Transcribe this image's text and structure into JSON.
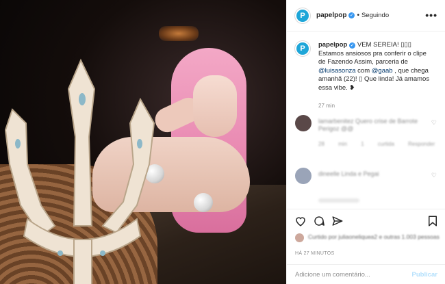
{
  "post": {
    "username": "papelpop",
    "follow_status": "Seguindo",
    "dot": "•",
    "more": "•••",
    "avatar_letter": "P"
  },
  "caption": {
    "username": "papelpop",
    "line1": " VEM SEREIA! ",
    "emoji": "▯▯▯",
    "line2": "Estamos ansiosos pra conferir o clipe de Fazendo Assim, parceria de ",
    "mention1": "@luisasonza",
    "line3": " com ",
    "mention2": "@gaab",
    "line4": " , que chega amanhã (22)! ",
    "emoji2": "▯",
    "line5": " Que linda! Já amamos essa vibe. ",
    "time": "27 min"
  },
  "comments": [
    {
      "text": "lamarbenitez Quero crise de Barrote Perigoz @@",
      "meta": "28 min 1 curtida Responder",
      "avatar_color": "#5a4848"
    },
    {
      "text": "dineelle Linda e Pegai",
      "meta": "",
      "avatar_color": "#9aa4b8"
    }
  ],
  "likes": {
    "text": "Curtido por juliaoneliquea2 e outras 1.003 pessoas"
  },
  "posted_time": "HÁ 27 MINUTOS",
  "add_comment": {
    "placeholder": "Adicione um comentário...",
    "publish_label": "Publicar"
  },
  "colors": {
    "brand": "#1ea6d8",
    "verified": "#3897f0",
    "publish": "#b2dffc"
  },
  "icons": [
    "heart-icon",
    "comment-icon",
    "share-icon",
    "bookmark-icon",
    "verified-badge-icon",
    "more-options-icon"
  ]
}
